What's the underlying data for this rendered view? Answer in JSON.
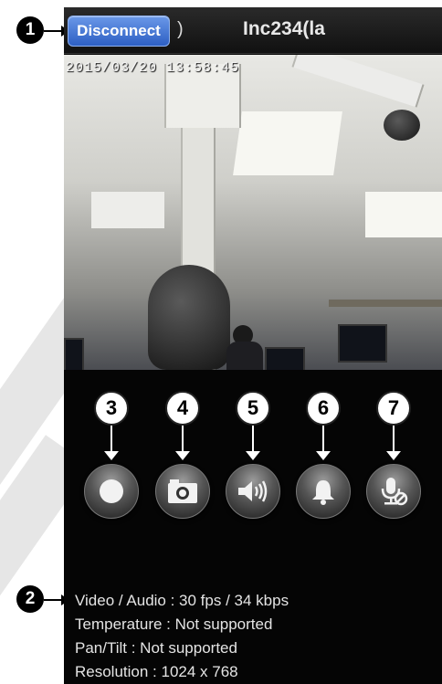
{
  "header": {
    "disconnect_label": "Disconnect",
    "paren": ")",
    "camera_title": "Inc234(la"
  },
  "video": {
    "timestamp": "2015/03/20 13:58:45"
  },
  "controls": [
    {
      "badge": "3",
      "icon": "record-icon"
    },
    {
      "badge": "4",
      "icon": "camera-snapshot-icon"
    },
    {
      "badge": "5",
      "icon": "speaker-icon"
    },
    {
      "badge": "6",
      "icon": "bell-icon"
    },
    {
      "badge": "7",
      "icon": "microphone-muted-icon"
    }
  ],
  "callouts": {
    "one": "1",
    "two": "2"
  },
  "info": {
    "video_audio": "Video / Audio : 30 fps / 34 kbps",
    "temperature": "Temperature : Not supported",
    "pan_tilt": "Pan/Tilt : Not supported",
    "resolution": "Resolution : 1024 x 768"
  },
  "colors": {
    "accent_button": "#2d5fc3",
    "background": "#050505"
  }
}
